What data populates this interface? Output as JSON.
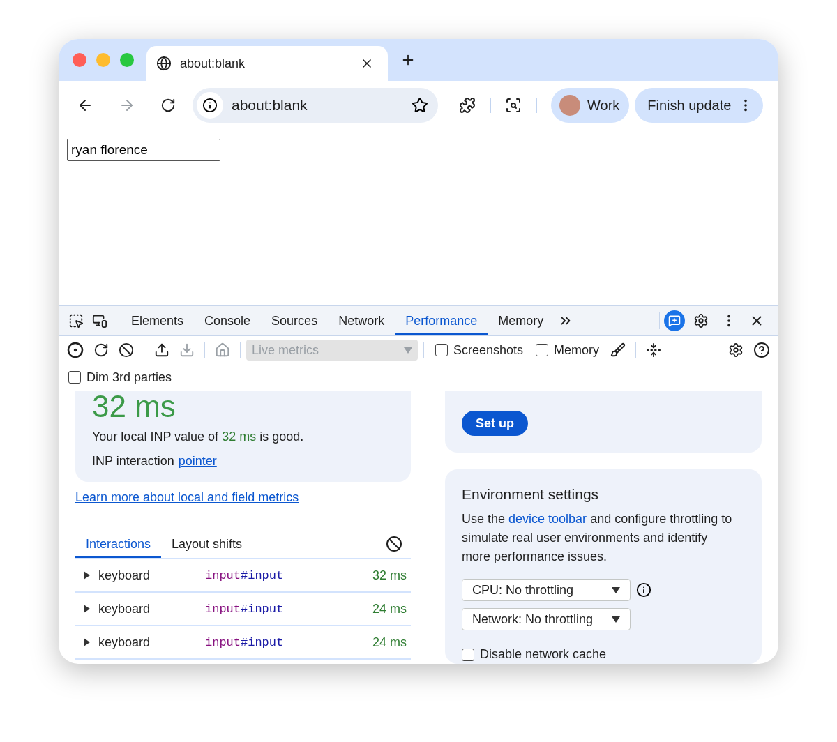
{
  "browser": {
    "tab": {
      "title": "about:blank"
    },
    "address": {
      "url": "about:blank"
    },
    "profile": {
      "name": "Work"
    },
    "update_button": {
      "label": "Finish update"
    }
  },
  "page": {
    "name_field": {
      "value": "ryan florence"
    }
  },
  "devtools": {
    "tabs": [
      {
        "label": "Elements",
        "selected": false
      },
      {
        "label": "Console",
        "selected": false
      },
      {
        "label": "Sources",
        "selected": false
      },
      {
        "label": "Network",
        "selected": false
      },
      {
        "label": "Performance",
        "selected": true
      },
      {
        "label": "Memory",
        "selected": false
      }
    ],
    "toolbar": {
      "live_metrics": {
        "placeholder": "Live metrics",
        "disabled": true
      },
      "checkboxes": [
        {
          "label": "Screenshots",
          "checked": false
        },
        {
          "label": "Memory",
          "checked": false
        }
      ]
    },
    "dim_checkbox": {
      "label": "Dim 3rd parties",
      "checked": false
    }
  },
  "inp_card": {
    "value": "32 ms",
    "sentence": {
      "prefix": "Your local INP value of ",
      "value": "32 ms",
      "suffix": " is good."
    },
    "interaction": {
      "label": "INP interaction ",
      "link": "pointer"
    }
  },
  "learn_more": "Learn more about local and field metrics",
  "subtabs": [
    {
      "label": "Interactions",
      "selected": true
    },
    {
      "label": "Layout shifts",
      "selected": false
    }
  ],
  "interactions": [
    {
      "type": "keyboard",
      "tag": "input",
      "id": "#input",
      "duration": "32 ms"
    },
    {
      "type": "keyboard",
      "tag": "input",
      "id": "#input",
      "duration": "24 ms"
    },
    {
      "type": "keyboard",
      "tag": "input",
      "id": "#input",
      "duration": "24 ms"
    }
  ],
  "setup_button": "Set up",
  "environment": {
    "title": "Environment settings",
    "text": {
      "before": "Use the ",
      "link": "device toolbar",
      "after": " and configure throttling to simulate real user environments and identify more performance issues."
    },
    "selects": [
      {
        "value": "CPU: No throttling",
        "info": true
      },
      {
        "value": "Network: No throttling",
        "info": false
      }
    ],
    "cache_checkbox": {
      "label": "Disable network cache",
      "checked": false
    }
  }
}
